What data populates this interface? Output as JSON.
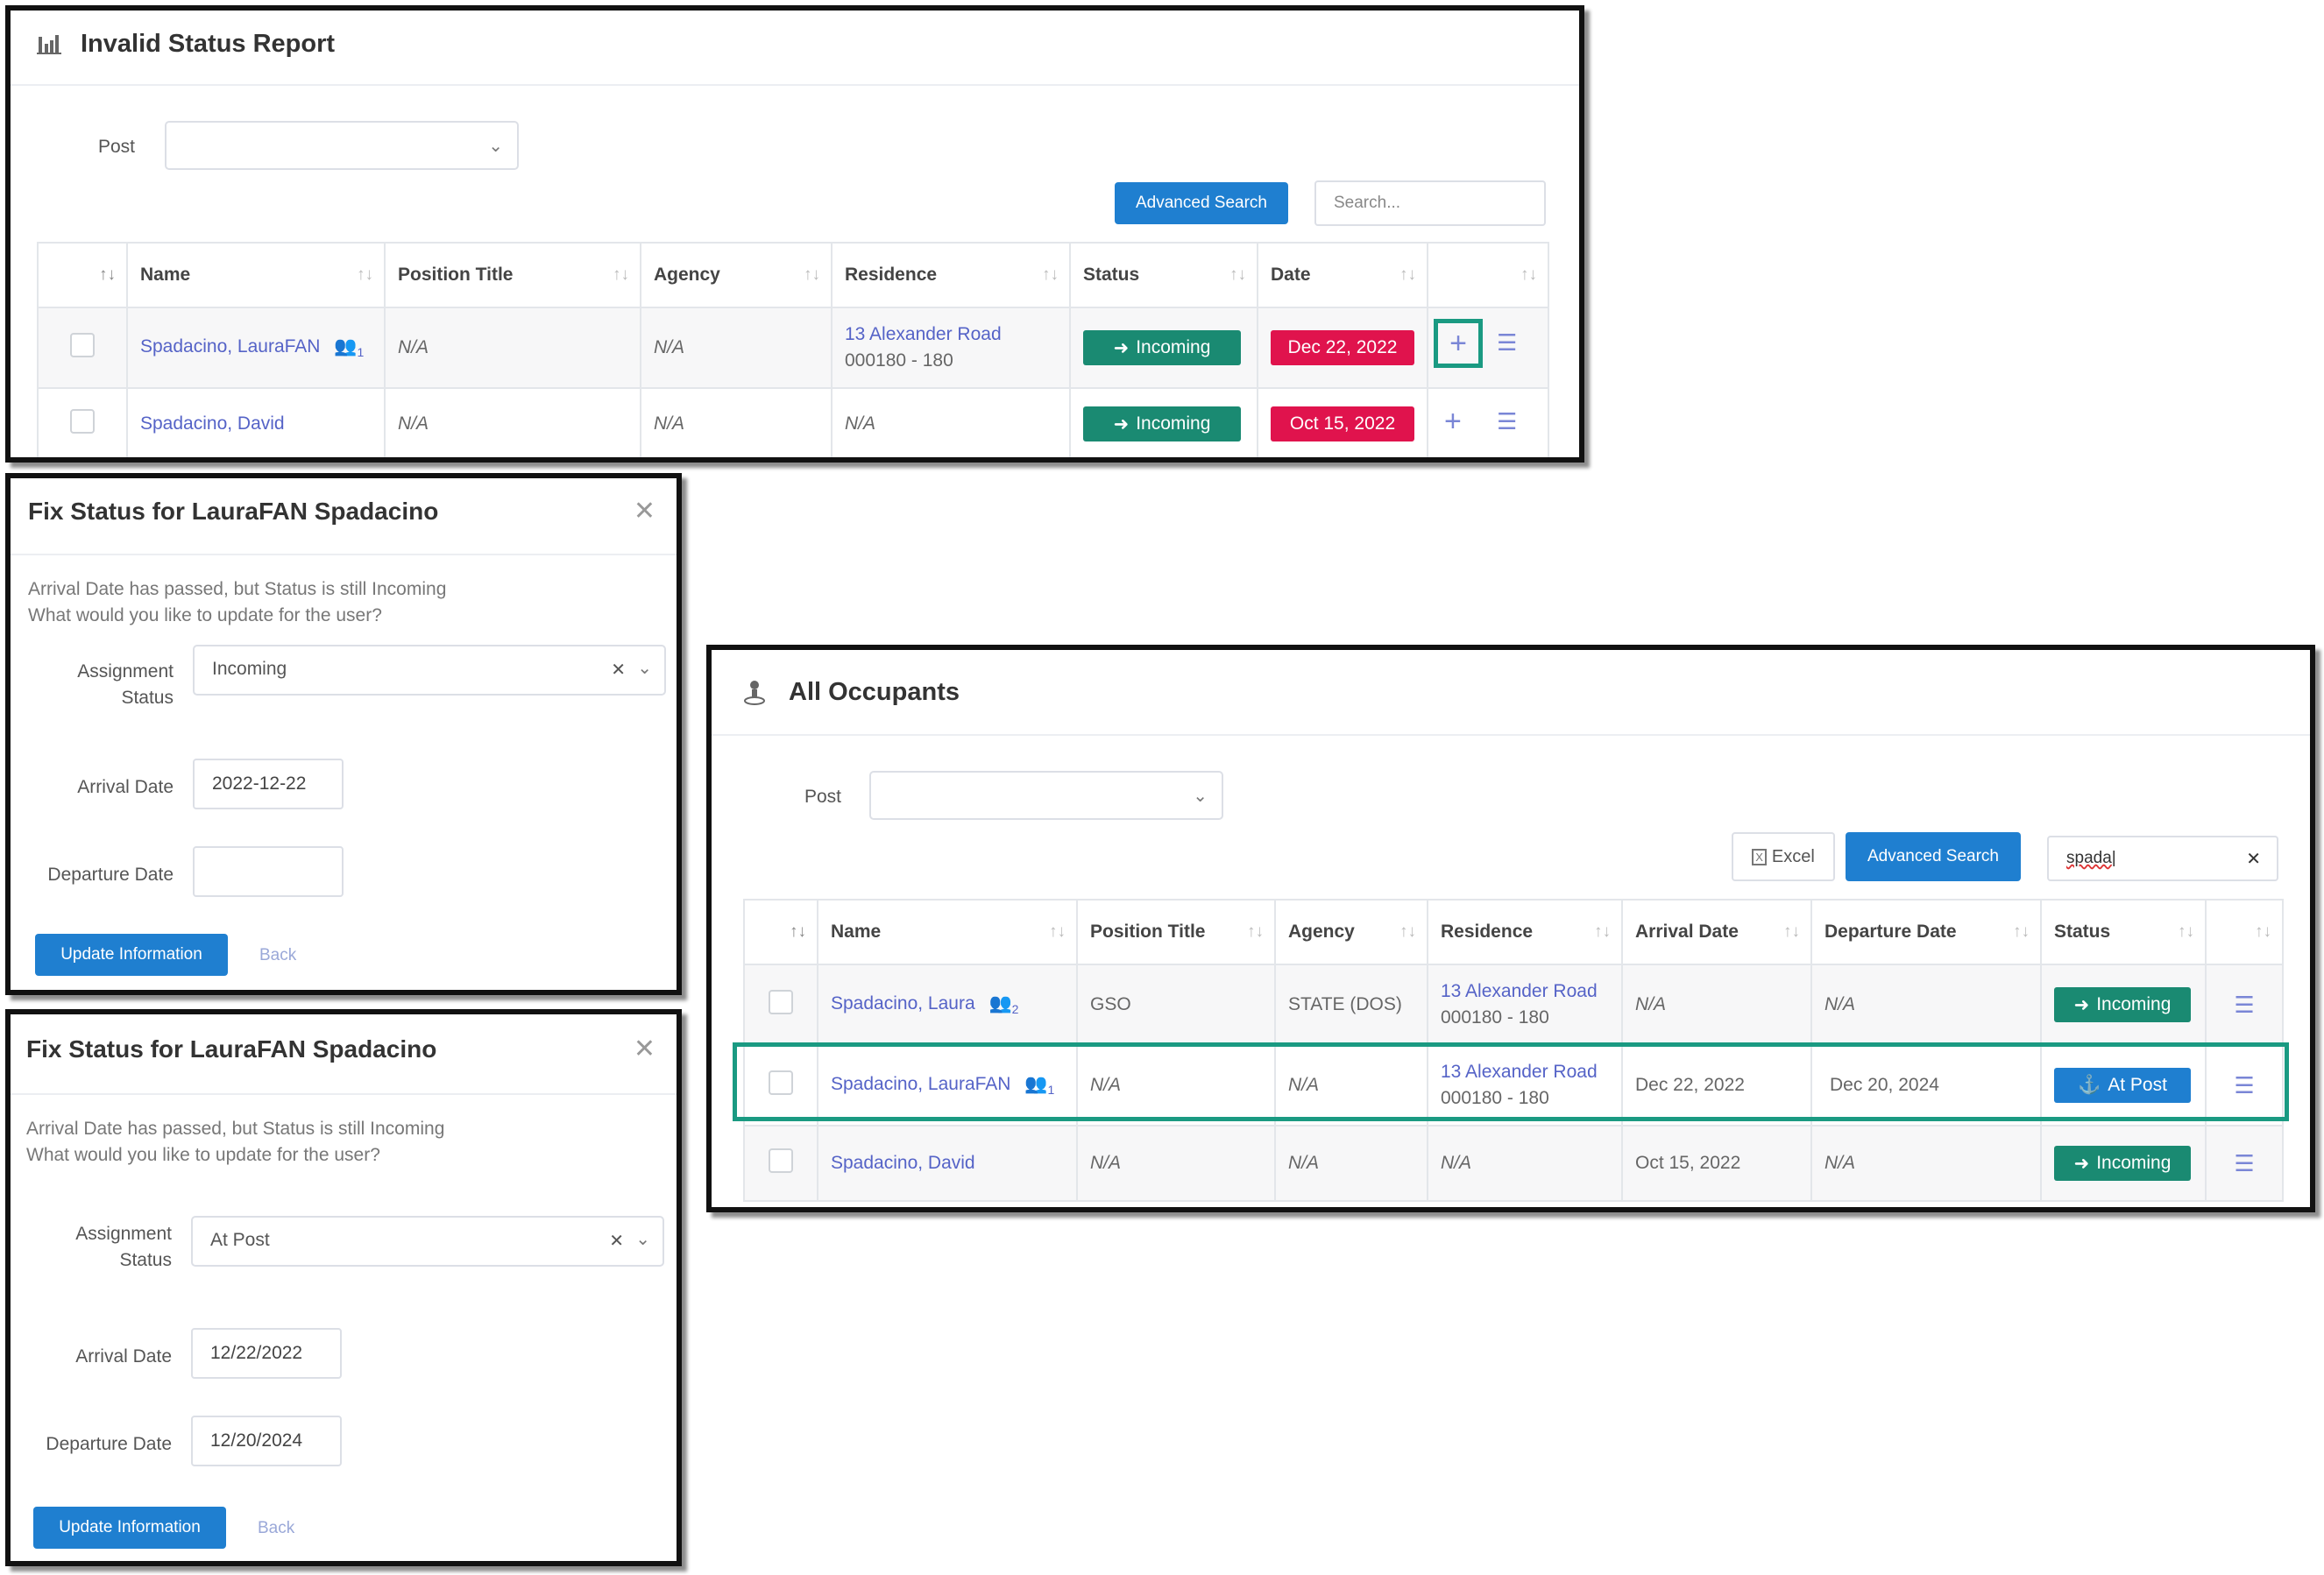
{
  "report": {
    "title": "Invalid Status Report",
    "title_icon": "bar-chart-icon",
    "post_label": "Post",
    "post_value": "",
    "advanced_search": "Advanced Search",
    "search_placeholder": "Search...",
    "columns": [
      "Name",
      "Position Title",
      "Agency",
      "Residence",
      "Status",
      "Date"
    ],
    "rows": [
      {
        "name": "Spadacino, LauraFAN",
        "family_count": "1",
        "position": "N/A",
        "agency": "N/A",
        "residence_line1": "13 Alexander Road",
        "residence_line2": "000180 - 180",
        "status": "Incoming",
        "date": "Dec 22, 2022"
      },
      {
        "name": "Spadacino, David",
        "family_count": "",
        "position": "N/A",
        "agency": "N/A",
        "residence_line1": "N/A",
        "residence_line2": "",
        "status": "Incoming",
        "date": "Oct 15, 2022"
      }
    ]
  },
  "modal1": {
    "title": "Fix Status for LauraFAN Spadacino",
    "message_line1": "Arrival Date has passed, but Status is still Incoming",
    "message_line2": "What would you like to update for the user?",
    "assignment_label_1": "Assignment",
    "assignment_label_2": "Status",
    "assignment_value": "Incoming",
    "arrival_label": "Arrival Date",
    "arrival_value": "2022-12-22",
    "departure_label": "Departure Date",
    "departure_value": "",
    "update_button": "Update Information",
    "back": "Back"
  },
  "modal2": {
    "title": "Fix Status for LauraFAN Spadacino",
    "message_line1": "Arrival Date has passed, but Status is still Incoming",
    "message_line2": "What would you like to update for the user?",
    "assignment_label_1": "Assignment",
    "assignment_label_2": "Status",
    "assignment_value": "At Post",
    "arrival_label": "Arrival Date",
    "arrival_value": "12/22/2022",
    "departure_label": "Departure Date",
    "departure_value": "12/20/2024",
    "update_button": "Update Information",
    "back": "Back"
  },
  "occupants": {
    "title": "All Occupants",
    "title_icon": "person-pin-icon",
    "post_label": "Post",
    "post_value": "",
    "excel": "Excel",
    "advanced_search": "Advanced Search",
    "search_value": "spada",
    "columns": [
      "Name",
      "Position Title",
      "Agency",
      "Residence",
      "Arrival Date",
      "Departure Date",
      "Status"
    ],
    "rows": [
      {
        "name": "Spadacino, Laura",
        "family_count": "2",
        "position": "GSO",
        "agency": "STATE (DOS)",
        "residence_line1": "13 Alexander Road",
        "residence_line2": "000180 - 180",
        "arrival": "N/A",
        "departure": "N/A",
        "status": "Incoming"
      },
      {
        "name": "Spadacino, LauraFAN",
        "family_count": "1",
        "position": "N/A",
        "agency": "N/A",
        "residence_line1": "13 Alexander Road",
        "residence_line2": "000180 - 180",
        "arrival": "Dec 22, 2022",
        "departure": "Dec 20, 2024",
        "status": "At Post"
      },
      {
        "name": "Spadacino, David",
        "family_count": "",
        "position": "N/A",
        "agency": "N/A",
        "residence_line1": "N/A",
        "residence_line2": "",
        "arrival": "Oct 15, 2022",
        "departure": "N/A",
        "status": "Incoming"
      }
    ]
  },
  "colors": {
    "primary": "#1f7fd0",
    "success": "#1a8a72",
    "danger": "#e0134d",
    "highlight": "#1a9a82",
    "link": "#5563c7"
  }
}
